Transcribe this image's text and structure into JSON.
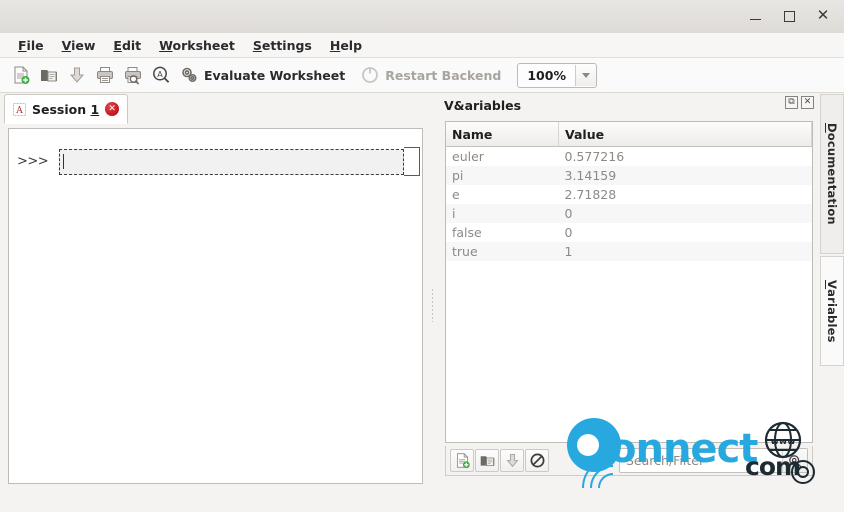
{
  "window": {
    "minimize_label": "–",
    "maximize_label": "□",
    "close_label": "×"
  },
  "menubar": {
    "items": [
      {
        "pre": "",
        "mnemonic": "F",
        "post": "ile"
      },
      {
        "pre": "",
        "mnemonic": "V",
        "post": "iew"
      },
      {
        "pre": "",
        "mnemonic": "E",
        "post": "dit"
      },
      {
        "pre": "",
        "mnemonic": "W",
        "post": "orksheet"
      },
      {
        "pre": "",
        "mnemonic": "S",
        "post": "ettings"
      },
      {
        "pre": "",
        "mnemonic": "H",
        "post": "elp"
      }
    ]
  },
  "toolbar": {
    "new_worksheet_icon": "new-document-icon",
    "open_worksheet_icon": "open-folder-icon",
    "save_worksheet_icon": "save-download-icon",
    "print_icon": "print-icon",
    "print_preview_icon": "print-preview-icon",
    "find_icon": "find-text-icon",
    "evaluate_icon": "gears-icon",
    "evaluate_label": "Evaluate Worksheet",
    "restart_icon": "restart-power-icon",
    "restart_label": "Restart Backend",
    "zoom_value": "100%",
    "zoom_arrow_icon": "chevron-down-icon"
  },
  "tabs": {
    "session": {
      "icon": "session-icon",
      "pre": "Session ",
      "mnemonic": "1",
      "post": "",
      "close_label": "✕"
    }
  },
  "worksheet": {
    "prompt": ">>>",
    "command_value": "",
    "command_placeholder": ""
  },
  "variables_dock": {
    "title": "V&ariables",
    "float_icon": "⧉",
    "close_icon": "✕",
    "columns": [
      "Name",
      "Value"
    ],
    "rows": [
      {
        "name": "euler",
        "value": "0.577216"
      },
      {
        "name": "pi",
        "value": "3.14159"
      },
      {
        "name": "e",
        "value": "2.71828"
      },
      {
        "name": "i",
        "value": "0"
      },
      {
        "name": "false",
        "value": "0"
      },
      {
        "name": "true",
        "value": "1"
      }
    ],
    "toolbar": {
      "new_icon": "new-document-icon",
      "open_icon": "open-folder-icon",
      "save_icon": "save-download-icon",
      "clear_icon": "no-entry-icon",
      "filter_value": "",
      "filter_placeholder": "Search/Filter",
      "filter_icon": "magnifier-icon"
    }
  },
  "side_tabs": [
    {
      "pre": "",
      "mnemonic": "D",
      "post": "ocumentation"
    },
    {
      "pre": "",
      "mnemonic": "V",
      "post": "ariables"
    }
  ],
  "watermark": {
    "brand": "onnect",
    "suffix": "com",
    "globe_icon": "www-globe-icon",
    "registered_icon": "registered-mark-icon"
  },
  "colors": {
    "accent": "#27a9e0",
    "close_red": "#c0121a",
    "chrome": "#f4f3f2"
  }
}
